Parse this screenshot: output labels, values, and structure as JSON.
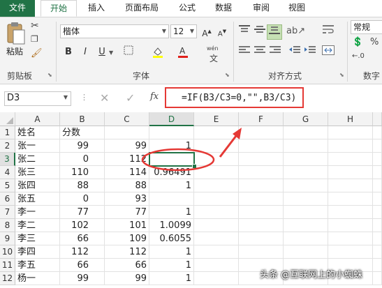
{
  "tabs": [
    "文件",
    "开始",
    "插入",
    "页面布局",
    "公式",
    "数据",
    "审阅",
    "视图"
  ],
  "ribbon": {
    "paste_label": "粘贴",
    "clipboard_label": "剪贴板",
    "font_name": "楷体",
    "font_size": "12",
    "font_group_label": "字体",
    "align_group_label": "对齐方式",
    "number_format": "常规",
    "number_group_label": "数字",
    "bold": "B",
    "italic": "I",
    "underline": "U",
    "wen": "wén"
  },
  "formula_bar": {
    "name_box": "D3",
    "fx": "fx",
    "formula": "=IF(B3/C3=0,\"\",B3/C3)"
  },
  "columns": [
    "A",
    "B",
    "C",
    "D",
    "E",
    "F",
    "G",
    "H"
  ],
  "selected_cell": "D3",
  "rows": [
    {
      "n": "1",
      "a": "姓名",
      "b": "分数",
      "c": "",
      "d": ""
    },
    {
      "n": "2",
      "a": "张一",
      "b": "99",
      "c": "99",
      "d": "1"
    },
    {
      "n": "3",
      "a": "张二",
      "b": "0",
      "c": "112",
      "d": ""
    },
    {
      "n": "4",
      "a": "张三",
      "b": "110",
      "c": "114",
      "d": "0.96491"
    },
    {
      "n": "5",
      "a": "张四",
      "b": "88",
      "c": "88",
      "d": "1"
    },
    {
      "n": "6",
      "a": "张五",
      "b": "0",
      "c": "93",
      "d": ""
    },
    {
      "n": "7",
      "a": "李一",
      "b": "77",
      "c": "77",
      "d": "1"
    },
    {
      "n": "8",
      "a": "李二",
      "b": "102",
      "c": "101",
      "d": "1.0099"
    },
    {
      "n": "9",
      "a": "李三",
      "b": "66",
      "c": "109",
      "d": "0.6055"
    },
    {
      "n": "10",
      "a": "李四",
      "b": "112",
      "c": "112",
      "d": "1"
    },
    {
      "n": "11",
      "a": "李五",
      "b": "66",
      "c": "66",
      "d": "1"
    },
    {
      "n": "12",
      "a": "杨一",
      "b": "99",
      "c": "99",
      "d": "1"
    }
  ],
  "watermark": "头条 @互联网上的小蜘蛛",
  "colors": {
    "accent": "#217346",
    "annotation": "#e53935"
  }
}
